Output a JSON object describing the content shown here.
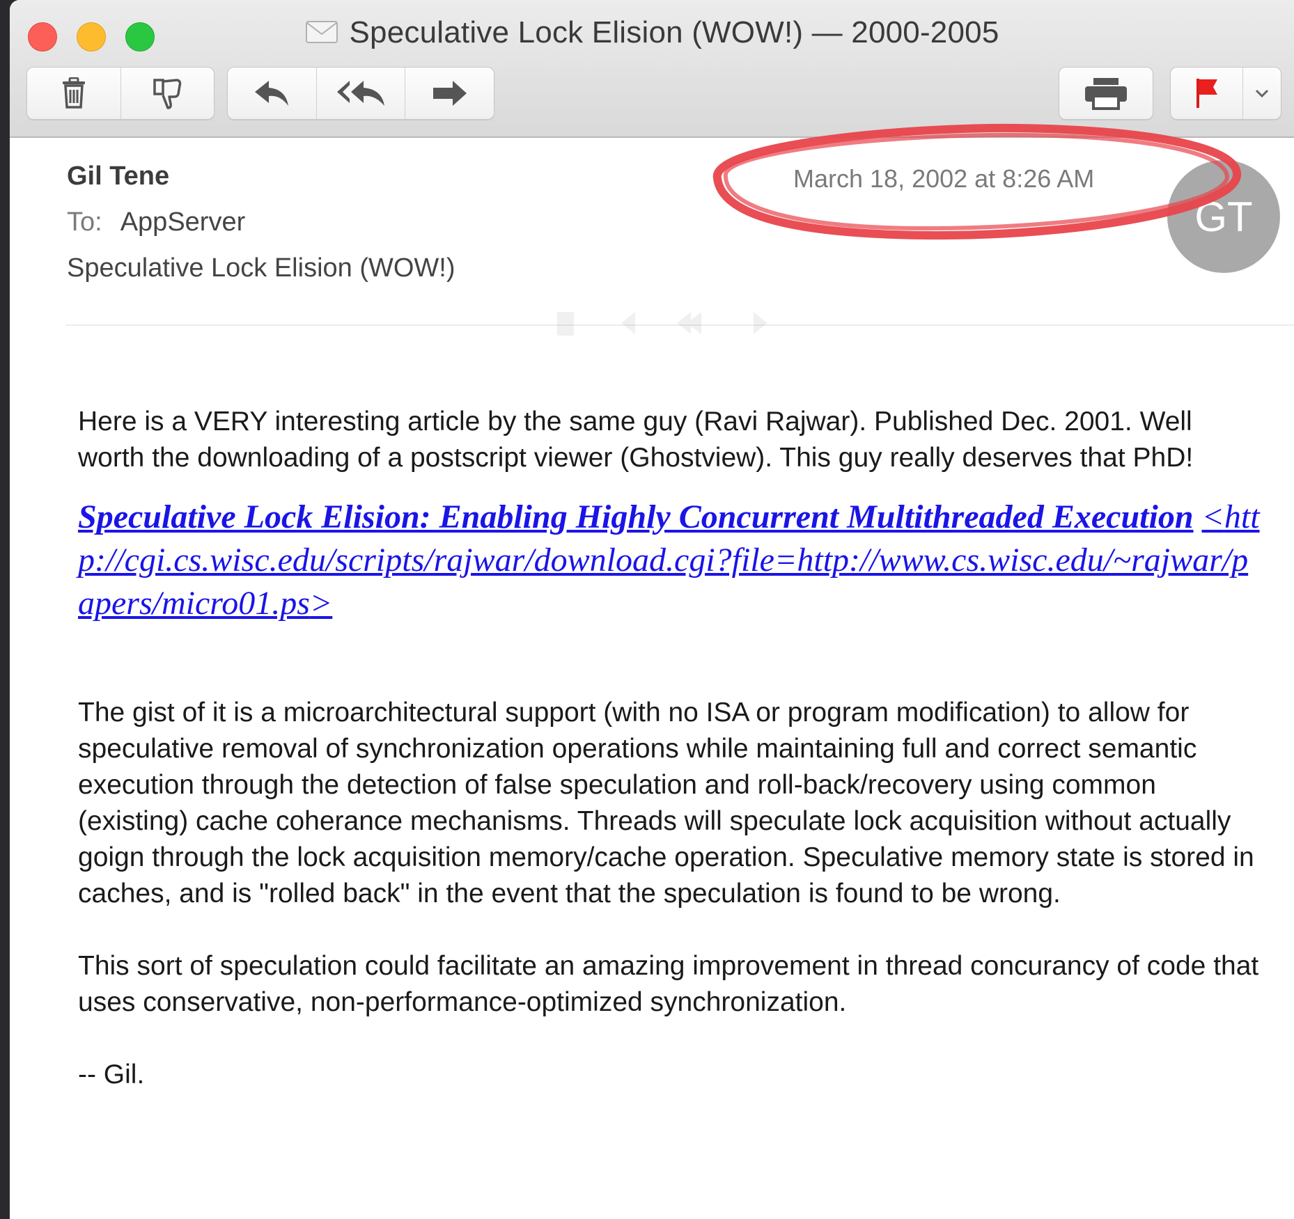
{
  "window": {
    "title": "Speculative Lock Elision (WOW!) — 2000-2005"
  },
  "toolbar": {
    "buttons": [
      {
        "name": "trash-button",
        "icon": "trash-icon"
      },
      {
        "name": "junk-button",
        "icon": "thumbs-down-icon"
      },
      {
        "name": "reply-button",
        "icon": "reply-icon"
      },
      {
        "name": "reply-all-button",
        "icon": "reply-all-icon"
      },
      {
        "name": "forward-button",
        "icon": "forward-icon"
      },
      {
        "name": "print-button",
        "icon": "printer-icon"
      },
      {
        "name": "flag-button",
        "icon": "red-flag-icon"
      },
      {
        "name": "flag-menu-button",
        "icon": "chevron-down-icon"
      }
    ],
    "flag_color": "#e8201e"
  },
  "header": {
    "sender": "Gil Tene",
    "to_label": "To:",
    "to_value": "AppServer",
    "subject": "Speculative Lock Elision (WOW!)",
    "date": "March 18, 2002 at 8:26 AM",
    "avatar_initials": "GT",
    "annotation_color": "#e8454b"
  },
  "body": {
    "para1": "Here is a VERY interesting article by the same guy (Ravi Rajwar). Published Dec. 2001. Well worth the downloading of a postscript viewer (Ghostview). This guy really deserves that PhD!",
    "link_title": "Speculative Lock Elision: Enabling Highly Concurrent Multithreaded Execution",
    "link_open": "<",
    "link_url": "http://cgi.cs.wisc.edu/scripts/rajwar/download.cgi?file=http://www.cs.wisc.edu/~rajwar/papers/micro01.ps",
    "link_close": ">",
    "para2": "The gist of it is a microarchitectural support (with no ISA or program modification) to allow for speculative removal of synchronization operations while maintaining full and correct semantic execution through the detection of false speculation and roll-back/recovery using common (existing) cache coherance mechanisms. Threads will speculate lock acquisition without actually goign through the lock acquisition memory/cache operation. Speculative memory state is stored in caches, and is \"rolled back\" in the event that the speculation is found to be wrong.",
    "para3": "This sort of speculation could facilitate an amazing  improvement in thread concurancy of code that uses conservative, non-performance-optimized synchronization.",
    "signature": "-- Gil."
  }
}
